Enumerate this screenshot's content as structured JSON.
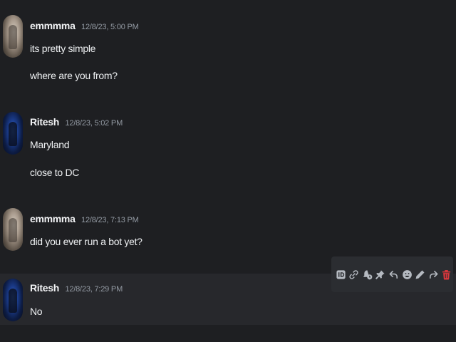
{
  "messages": [
    {
      "username": "emmmma",
      "timestamp": "12/8/23, 5:00 PM",
      "lines": [
        "its pretty simple",
        "where are you from?"
      ]
    },
    {
      "username": "Ritesh",
      "timestamp": "12/8/23, 5:02 PM",
      "lines": [
        "Maryland",
        "close to DC"
      ]
    },
    {
      "username": "emmmma",
      "timestamp": "12/8/23, 7:13 PM",
      "lines": [
        "did you ever run a bot yet?"
      ]
    },
    {
      "username": "Ritesh",
      "timestamp": "12/8/23, 7:29 PM",
      "lines": [
        "No"
      ]
    }
  ],
  "toolbar": {
    "icons": [
      "id-icon",
      "link-icon",
      "reminder-icon",
      "pin-icon",
      "reply-icon",
      "emoji-icon",
      "edit-icon",
      "forward-icon",
      "delete-icon"
    ],
    "delete_color": "#da373c"
  },
  "colors": {
    "background": "#1e1f22",
    "hover_background": "#27282c",
    "toolbar_background": "#2b2d31",
    "timestamp": "#949ba4"
  }
}
